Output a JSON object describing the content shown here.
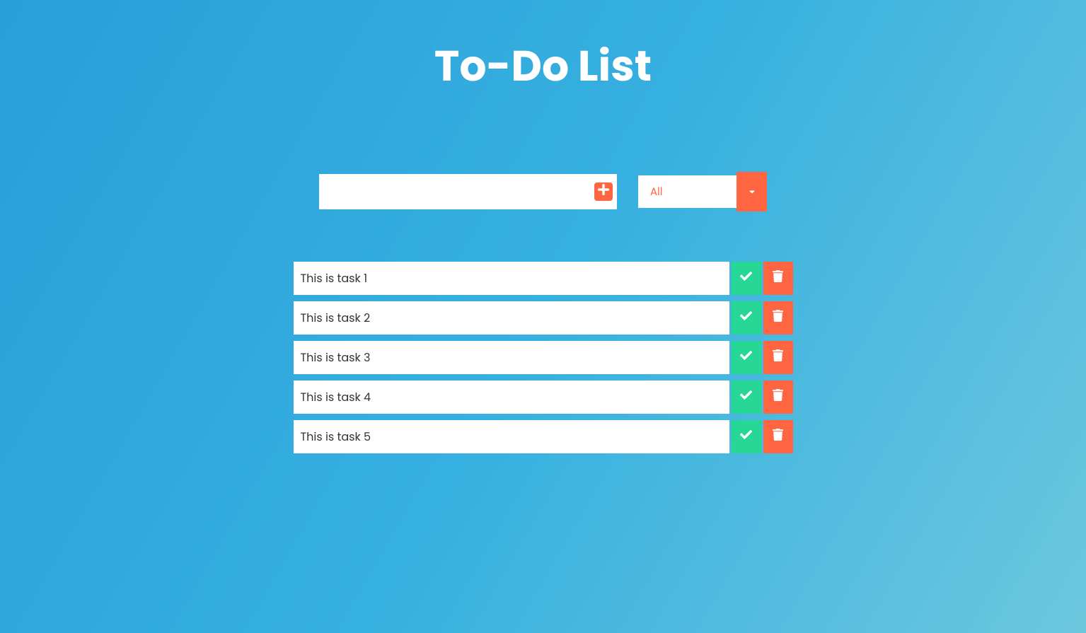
{
  "header": {
    "title": "To-Do List"
  },
  "input": {
    "value": "",
    "placeholder": ""
  },
  "filter": {
    "selected": "All"
  },
  "tasks": [
    {
      "label": "This is task 1"
    },
    {
      "label": "This is task 2"
    },
    {
      "label": "This is task 3"
    },
    {
      "label": "This is task 4"
    },
    {
      "label": "This is task 5"
    }
  ],
  "colors": {
    "accent": "#ff6541",
    "success": "#27d796",
    "background_start": "#2a9ed8",
    "background_end": "#6cc7de"
  }
}
